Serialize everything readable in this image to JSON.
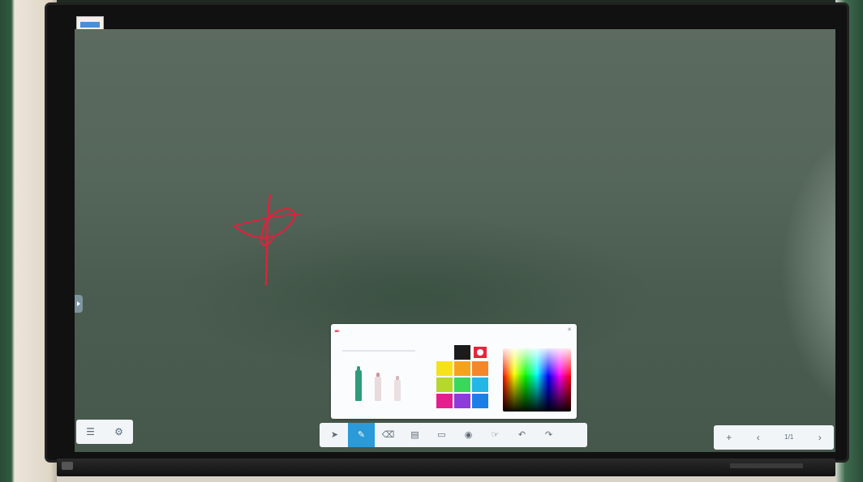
{
  "colors": {
    "toolbar_bg": "#f2f5f8",
    "active_tool": "#2a9ad8",
    "ink": "#e1213c"
  },
  "left_toolbar": [
    {
      "icon": "menu-icon",
      "label": ""
    },
    {
      "icon": "settings-icon",
      "label": ""
    }
  ],
  "main_toolbar": [
    {
      "icon": "select-icon",
      "label": ""
    },
    {
      "icon": "pen-icon",
      "label": "",
      "active": true
    },
    {
      "icon": "eraser-icon",
      "label": ""
    },
    {
      "icon": "clear-icon",
      "label": ""
    },
    {
      "icon": "shapes-icon",
      "label": ""
    },
    {
      "icon": "fill-icon",
      "label": ""
    },
    {
      "icon": "gesture-icon",
      "label": ""
    },
    {
      "icon": "undo-icon",
      "label": ""
    },
    {
      "icon": "redo-icon",
      "label": ""
    }
  ],
  "right_toolbar": [
    {
      "icon": "add-page-icon",
      "label": ""
    },
    {
      "icon": "prev-page-icon",
      "label": ""
    },
    {
      "icon": "page-indicator",
      "label": "1/1"
    },
    {
      "icon": "next-page-icon",
      "label": ""
    }
  ],
  "pen_panel": {
    "pen_types": [
      "highlighter-pen",
      "fine-pen",
      "soft-pen"
    ],
    "swatches": [
      "#1b1b1b",
      "#e8253b",
      "#f6e21a",
      "#f5a21c",
      "#f3872a",
      "#b5d82a",
      "#39d85a",
      "#23b7e8",
      "#e61d8f",
      "#8d3bdc",
      "#1c7fe8"
    ],
    "selected_swatch": "#e8253b"
  }
}
